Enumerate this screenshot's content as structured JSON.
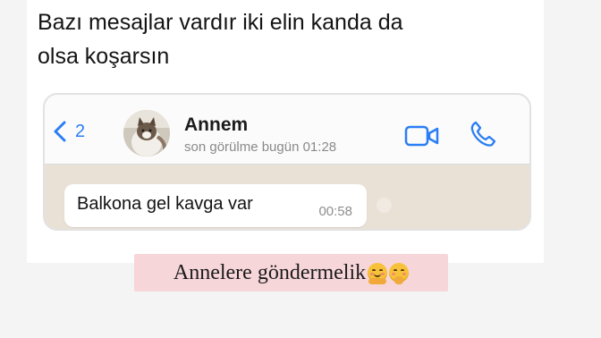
{
  "tweet": {
    "text_line1": "Bazı mesajlar vardır iki elin kanda da",
    "text_line2": "olsa koşarsın"
  },
  "chat_header": {
    "back_count": "2",
    "contact_name": "Annem",
    "last_seen": "son görülme bugün 01:28",
    "icons": [
      "chevron-left-icon",
      "video-camera-icon",
      "phone-icon"
    ],
    "accent_color": "#2a7ef4"
  },
  "message": {
    "text": "Balkona gel kavga var",
    "time": "00:58"
  },
  "caption": {
    "text": "Annelere göndermelik",
    "emojis": [
      "hugging-face-emoji",
      "shushing-face-emoji"
    ],
    "background": "#f7d6da"
  }
}
